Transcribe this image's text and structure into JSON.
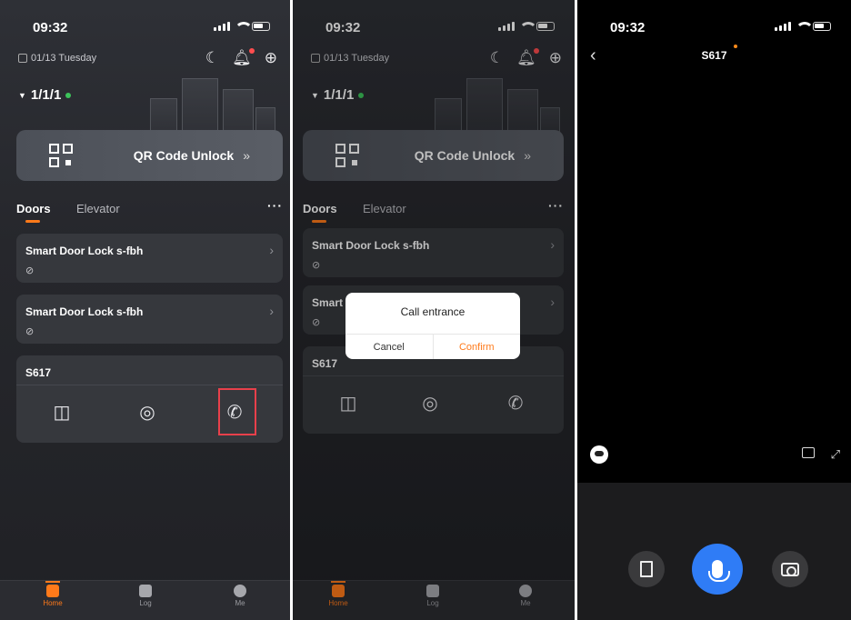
{
  "status": {
    "time": "09:32"
  },
  "home": {
    "date": "01/13 Tuesday",
    "site": "1/1/1",
    "qr_label": "QR Code Unlock",
    "qr_chevron": "»",
    "tabs": {
      "doors": "Doors",
      "elevator": "Elevator",
      "more": "···"
    },
    "cards": [
      {
        "name": "Smart Door Lock s-fbh"
      },
      {
        "name": "Smart Door Lock s-fbh"
      }
    ],
    "device": {
      "name": "S617"
    },
    "tabbar": {
      "home": "Home",
      "log": "Log",
      "me": "Me"
    }
  },
  "dialog": {
    "title": "Call entrance",
    "cancel": "Cancel",
    "confirm": "Confirm"
  },
  "call": {
    "title": "S617"
  },
  "icons": {
    "calendar": "calendar-icon",
    "moon": "moon-icon",
    "bell": "bell-icon",
    "add": "add-icon",
    "door": "door-icon",
    "monitor": "camera-monitor-icon",
    "call": "call-icon",
    "mic": "microphone-icon",
    "snapshot": "camera-icon"
  },
  "colors": {
    "accent": "#ff7a1a",
    "online": "#3cc35a",
    "highlight": "#e8404b",
    "mic": "#2f7cf6"
  }
}
